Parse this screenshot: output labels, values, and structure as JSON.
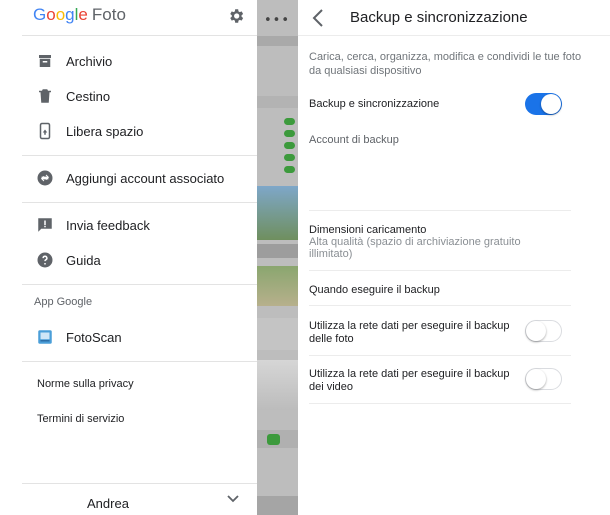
{
  "drawer": {
    "logo": {
      "word": [
        "G",
        "o",
        "o",
        "g",
        "l",
        "e"
      ],
      "app": "Foto"
    },
    "items": [
      {
        "label": "Archivio",
        "icon": "archive-icon"
      },
      {
        "label": "Cestino",
        "icon": "trash-icon"
      },
      {
        "label": "Libera spazio",
        "icon": "free-space-icon"
      },
      {
        "label": "Aggiungi account associato",
        "icon": "linked-account-icon"
      },
      {
        "label": "Invia feedback",
        "icon": "feedback-icon"
      },
      {
        "label": "Guida",
        "icon": "help-icon"
      },
      {
        "label": "FotoScan",
        "icon": "fotoscan-icon"
      }
    ],
    "section_apps": "App Google",
    "privacy_link": "Norme sulla privacy",
    "terms_link": "Termini di servizio",
    "account_name": "Andrea"
  },
  "settings": {
    "title": "Backup e sincronizzazione",
    "description": "Carica, cerca, organizza, modifica e condividi le tue foto da qualsiasi dispositivo",
    "backup_sync_label": "Backup e sincronizzazione",
    "backup_sync_enabled": true,
    "backup_account_label": "Account di backup",
    "upload_size_label": "Dimensioni caricamento",
    "upload_size_value": "Alta qualità (spazio di archiviazione gratuito illimitato)",
    "when_backup_label": "Quando eseguire il backup",
    "photo_data_label": "Utilizza la rete dati per eseguire il backup delle foto",
    "photo_data_enabled": false,
    "video_data_label": "Utilizza la rete dati per eseguire il backup dei video",
    "video_data_enabled": false
  },
  "colors": {
    "toggle_on": "#1a73e8",
    "accent_blue": "#4285f4"
  }
}
